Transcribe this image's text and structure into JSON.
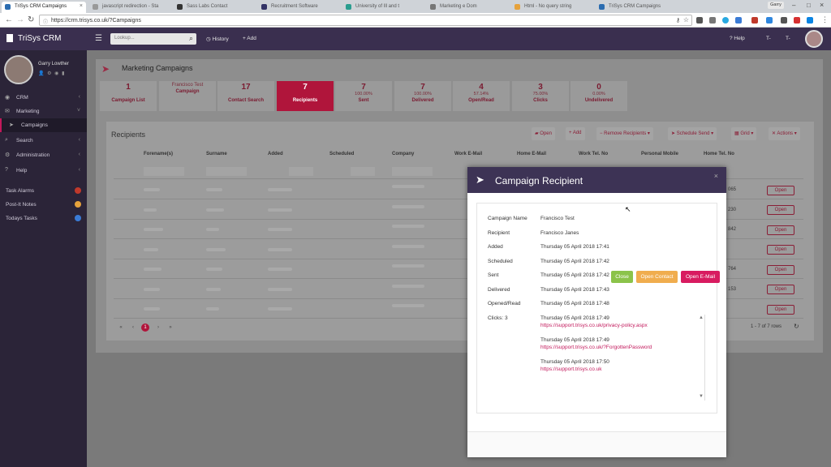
{
  "browser": {
    "tabs": [
      {
        "label": "TriSys CRM Campaigns",
        "active": true
      },
      {
        "label": "javascript redirection - Sta",
        "active": false
      },
      {
        "label": "Sass Labs Contact",
        "active": false
      },
      {
        "label": "Recruitment Software",
        "active": false
      },
      {
        "label": "University of Ill and t",
        "active": false
      },
      {
        "label": "Marketing e Dom",
        "active": false
      },
      {
        "label": "Html - No query string",
        "active": false
      },
      {
        "label": "TriSys CRM Campaigns",
        "active": false
      }
    ],
    "url": "https://crm.trisys.co.uk/?Campaigns",
    "profile_name": "Garry"
  },
  "app": {
    "brand": "TriSys CRM",
    "lookup_placeholder": "Lookup...",
    "history": "History",
    "add": "Add",
    "help": "Help",
    "t_minus": "T-",
    "t_plus": "T-"
  },
  "sidebar": {
    "user": "Garry Lowther",
    "items": [
      {
        "label": "CRM"
      },
      {
        "label": "Marketing"
      },
      {
        "label": "Campaigns"
      },
      {
        "label": "Search"
      },
      {
        "label": "Administration"
      },
      {
        "label": "Help"
      }
    ],
    "tasks": [
      {
        "label": "Task Alarms",
        "color": "#c0392b",
        "count": "0"
      },
      {
        "label": "Post-It Notes",
        "color": "#e6a23c",
        "count": "0"
      },
      {
        "label": "Todays Tasks",
        "color": "#3a7bd5",
        "count": "0"
      }
    ]
  },
  "page": {
    "title": "Marketing Campaigns"
  },
  "tiles": [
    {
      "number": "1",
      "pct": "",
      "label": "Campaign List"
    },
    {
      "number": "",
      "pct": "Francisco Test",
      "label": "Campaign"
    },
    {
      "number": "17",
      "pct": "",
      "label": "Contact Search"
    },
    {
      "number": "7",
      "pct": "",
      "label": "Recipients"
    },
    {
      "number": "7",
      "pct": "100.00%",
      "label": "Sent"
    },
    {
      "number": "7",
      "pct": "100.00%",
      "label": "Delivered"
    },
    {
      "number": "4",
      "pct": "57.14%",
      "label": "Open/Read"
    },
    {
      "number": "3",
      "pct": "75.00%",
      "label": "Clicks"
    },
    {
      "number": "0",
      "pct": "0.00%",
      "label": "Undelivered"
    }
  ],
  "recipients": {
    "title": "Recipients",
    "toolbar": {
      "open": "Open",
      "add": "Add",
      "remove": "Remove Recipients",
      "schedule": "Schedule Send",
      "grid": "Grid",
      "actions": "Actions"
    },
    "columns": [
      "Forename(s)",
      "Surname",
      "Added",
      "Scheduled",
      "Company",
      "Work E-Mail",
      "Home E-Mail",
      "Work Tel. No",
      "Personal Mobile",
      "Home Tel. No"
    ],
    "row_tel": [
      "065",
      "230",
      "842",
      "",
      "7 764",
      "0 153",
      ""
    ],
    "open_label": "Open",
    "page": "1",
    "range": "1 - 7 of 7 rows"
  },
  "modal": {
    "title": "Campaign Recipient",
    "fields": [
      {
        "label": "Campaign Name",
        "value": "Francisco Test"
      },
      {
        "label": "Recipient",
        "value": "Francisco Janes"
      },
      {
        "label": "Added",
        "value": "Thursday 05 April 2018 17:41"
      },
      {
        "label": "Scheduled",
        "value": "Thursday 05 April 2018 17:42"
      },
      {
        "label": "Sent",
        "value": "Thursday 05 April 2018 17:42"
      },
      {
        "label": "Delivered",
        "value": "Thursday 05 April 2018 17:43"
      },
      {
        "label": "Opened/Read",
        "value": "Thursday 05 April 2018 17:48"
      }
    ],
    "clicks_label": "Clicks: 3",
    "clicks": [
      {
        "time": "Thursday 05 April 2018 17:49",
        "url": "https://support.trisys.co.uk/privacy-policy.aspx"
      },
      {
        "time": "Thursday 05 April 2018 17:49",
        "url": "https://support.trisys.co.uk/?ForgottenPassword"
      },
      {
        "time": "Thursday 05 April 2018 17:50",
        "url": "https://support.trisys.co.uk"
      }
    ],
    "buttons": {
      "close": "Close",
      "open_contact": "Open Contact",
      "open_email": "Open E-Mail"
    }
  },
  "colors": {
    "accent": "#c2185b",
    "header": "#3d3355",
    "close_btn": "#8bc34a",
    "contact_btn": "#f0ad4e",
    "email_btn": "#d81b60"
  }
}
